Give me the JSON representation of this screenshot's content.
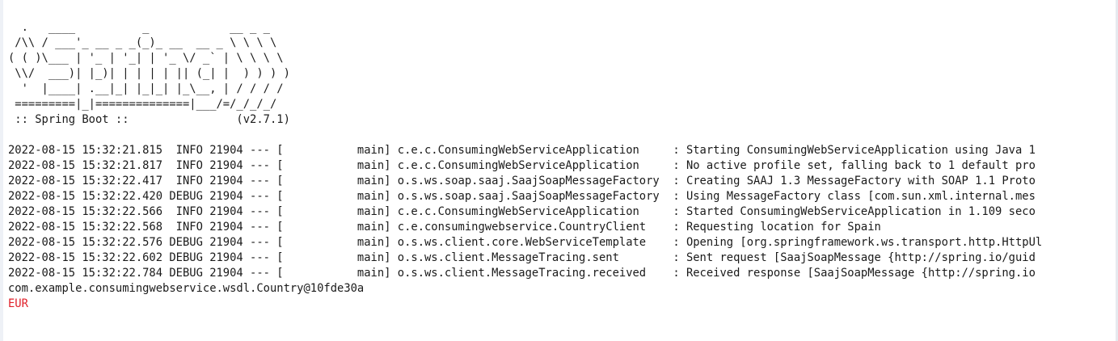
{
  "colors": {
    "background": "#ffffff",
    "text": "#1a1a1a",
    "stderr": "#e0202a"
  },
  "banner": [
    "  .   ____          _            __ _ _",
    " /\\\\ / ___'_ __ _ _(_)_ __  __ _ \\ \\ \\ \\",
    "( ( )\\___ | '_ | '_| | '_ \\/ _` | \\ \\ \\ \\",
    " \\\\/  ___)| |_)| | | | | || (_| |  ) ) ) )",
    "  '  |____| .__|_| |_|_| |_\\__, | / / / /",
    " =========|_|==============|___/=/_/_/_/",
    " :: Spring Boot ::                (v2.7.1)"
  ],
  "log": [
    "2022-08-15 15:32:21.815  INFO 21904 --- [           main] c.e.c.ConsumingWebServiceApplication     : Starting ConsumingWebServiceApplication using Java 1",
    "2022-08-15 15:32:21.817  INFO 21904 --- [           main] c.e.c.ConsumingWebServiceApplication     : No active profile set, falling back to 1 default pro",
    "2022-08-15 15:32:22.417  INFO 21904 --- [           main] o.s.ws.soap.saaj.SaajSoapMessageFactory  : Creating SAAJ 1.3 MessageFactory with SOAP 1.1 Proto",
    "2022-08-15 15:32:22.420 DEBUG 21904 --- [           main] o.s.ws.soap.saaj.SaajSoapMessageFactory  : Using MessageFactory class [com.sun.xml.internal.mes",
    "2022-08-15 15:32:22.566  INFO 21904 --- [           main] c.e.c.ConsumingWebServiceApplication     : Started ConsumingWebServiceApplication in 1.109 seco",
    "2022-08-15 15:32:22.568  INFO 21904 --- [           main] c.e.consumingwebservice.CountryClient    : Requesting location for Spain",
    "2022-08-15 15:32:22.576 DEBUG 21904 --- [           main] o.s.ws.client.core.WebServiceTemplate    : Opening [org.springframework.ws.transport.http.HttpUl",
    "2022-08-15 15:32:22.602 DEBUG 21904 --- [           main] o.s.ws.client.MessageTracing.sent        : Sent request [SaajSoapMessage {http://spring.io/guid",
    "2022-08-15 15:32:22.784 DEBUG 21904 --- [           main] o.s.ws.client.MessageTracing.received    : Received response [SaajSoapMessage {http://spring.io"
  ],
  "output": {
    "country": "com.example.consumingwebservice.wsdl.Country@10fde30a",
    "currency": "EUR"
  }
}
